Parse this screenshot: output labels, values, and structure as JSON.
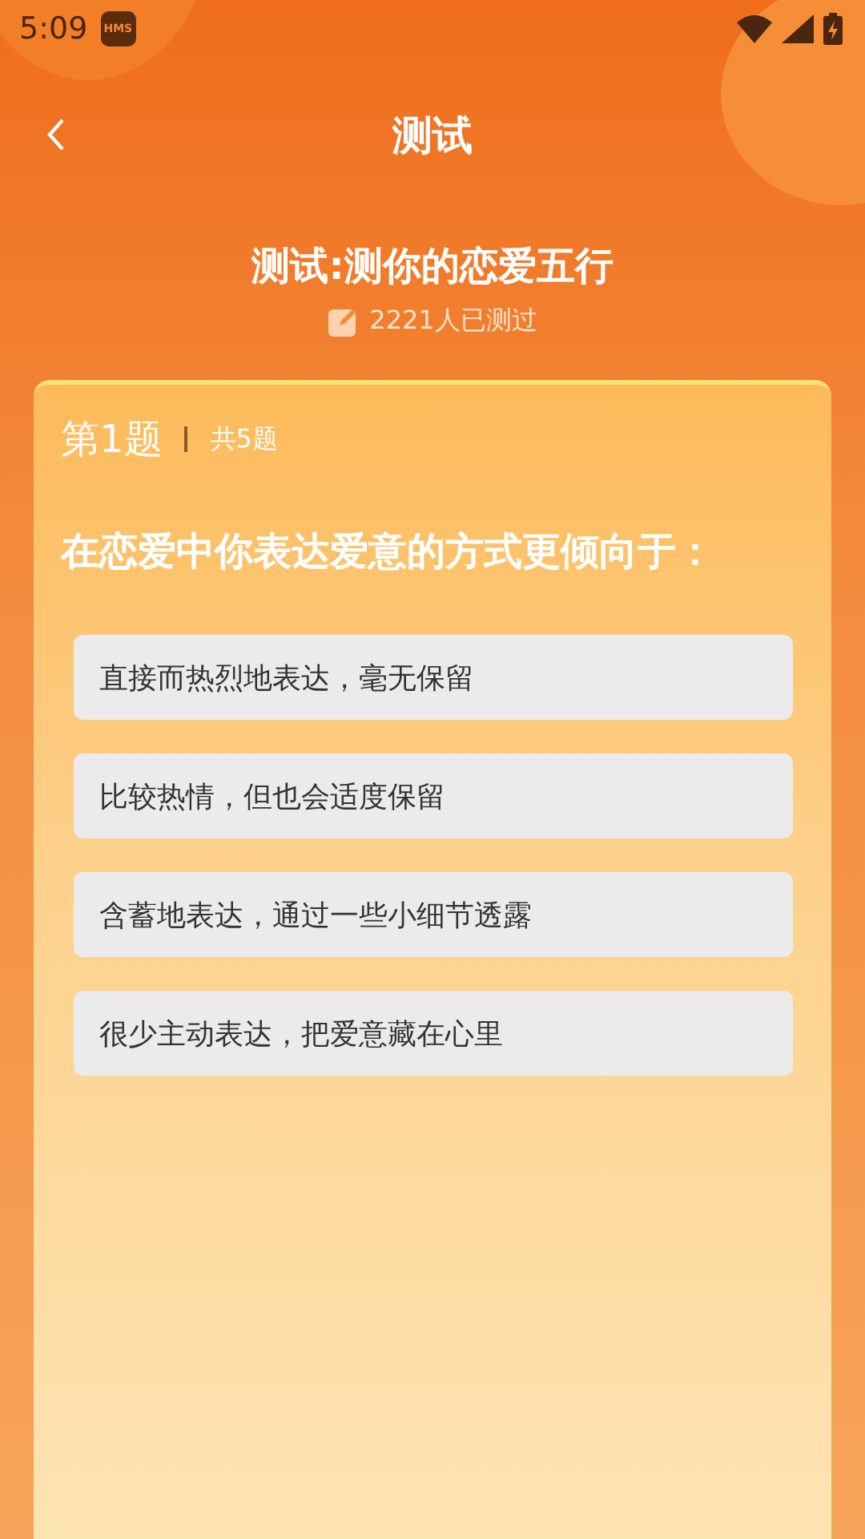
{
  "status_bar": {
    "time": "5:09",
    "badge": "HMS"
  },
  "header": {
    "title": "测试"
  },
  "quiz": {
    "title": "测试:测你的恋爱五行",
    "taken_count": "2221人已测过"
  },
  "question": {
    "number": "第1题",
    "total": "共5题",
    "text": "在恋爱中你表达爱意的方式更倾向于：",
    "options": [
      {
        "label": "直接而热烈地表达，毫无保留"
      },
      {
        "label": "比较热情，但也会适度保留"
      },
      {
        "label": "含蓄地表达，通过一些小细节透露"
      },
      {
        "label": "很少主动表达，把爱意藏在心里"
      }
    ]
  }
}
